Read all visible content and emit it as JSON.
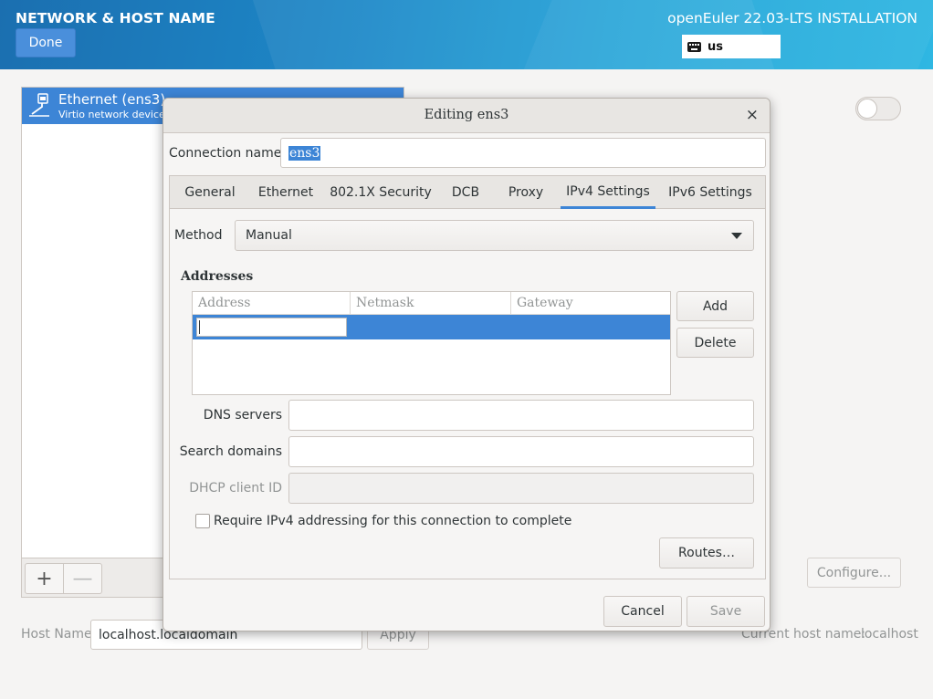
{
  "header": {
    "title": "NETWORK & HOST NAME",
    "done_label": "Done",
    "product": "openEuler 22.03-LTS INSTALLATION",
    "keyboard_layout": "us",
    "keyboard_icon": "keyboard-icon"
  },
  "devices": [
    {
      "name": "Ethernet (ens3)",
      "description": "Virtio network device",
      "icon": "network-wired-icon",
      "selected": true
    }
  ],
  "list_toolbar": {
    "add_symbol": "+",
    "remove_symbol": "—"
  },
  "configure_label": "Configure...",
  "hostname": {
    "label": "Host Name:",
    "value": "localhost.localdomain",
    "apply_label": "Apply",
    "current_label": "Current host name:",
    "current_value": "localhost"
  },
  "dialog": {
    "title": "Editing ens3",
    "close_symbol": "×",
    "connection_name_label": "Connection name",
    "connection_name_value": "ens3",
    "tabs": [
      "General",
      "Ethernet",
      "802.1X Security",
      "DCB",
      "Proxy",
      "IPv4 Settings",
      "IPv6 Settings"
    ],
    "active_tab": "IPv4 Settings",
    "method_label": "Method",
    "method_value": "Manual",
    "addresses_heading": "Addresses",
    "address_columns": [
      "Address",
      "Netmask",
      "Gateway"
    ],
    "add_label": "Add",
    "delete_label": "Delete",
    "dns_label": "DNS servers",
    "dns_value": "",
    "search_domains_label": "Search domains",
    "search_domains_value": "",
    "dhcp_client_id_label": "DHCP client ID",
    "dhcp_client_id_value": "",
    "require_ipv4_label": "Require IPv4 addressing for this connection to complete",
    "require_ipv4_checked": false,
    "routes_label": "Routes…",
    "cancel_label": "Cancel",
    "save_label": "Save"
  },
  "colors": {
    "accent": "#3d85d6",
    "header_start": "#1b6fb0",
    "header_end": "#2fb7e2"
  }
}
